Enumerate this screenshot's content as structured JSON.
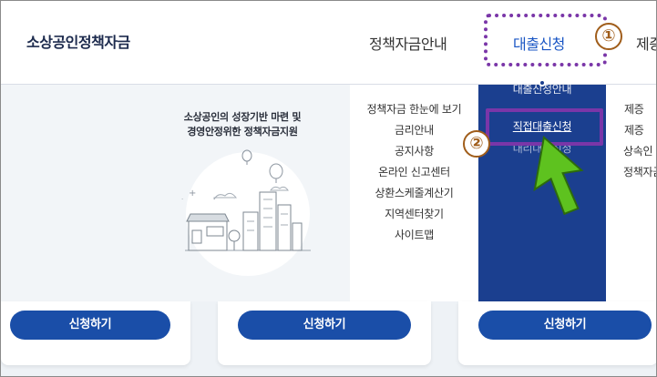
{
  "header": {
    "logo": "소상공인정책자금",
    "nav": [
      {
        "label": "정책자금안내"
      },
      {
        "label": "대출신청"
      },
      {
        "label": "제증"
      }
    ]
  },
  "annotations": {
    "step1": "①",
    "step2": "②"
  },
  "mega_menu": {
    "slogan_line1": "소상공인의 성장기반 마련 및",
    "slogan_line2": "경영안정위한 정책자금지원",
    "info_links": [
      "정책자금 한눈에 보기",
      "금리안내",
      "공지사항",
      "온라인 신고센터",
      "상환스케줄계산기",
      "지역센터찾기",
      "사이트맵"
    ],
    "loan_links": [
      "대출신청안내",
      "직접대출신청",
      "대리대출신청"
    ],
    "next_links": [
      "제증",
      "제증",
      "상속인",
      "정책자금"
    ]
  },
  "cards": [
    {
      "button": "신청하기"
    },
    {
      "button": "신청하기"
    },
    {
      "button": "신청하기"
    }
  ],
  "colors": {
    "primary_navy": "#1b3f8f",
    "button_blue": "#1a4ea8",
    "highlight_purple": "#7a36a8",
    "badge_brown": "#a05d1a",
    "cursor_green": "#5ec21f"
  }
}
